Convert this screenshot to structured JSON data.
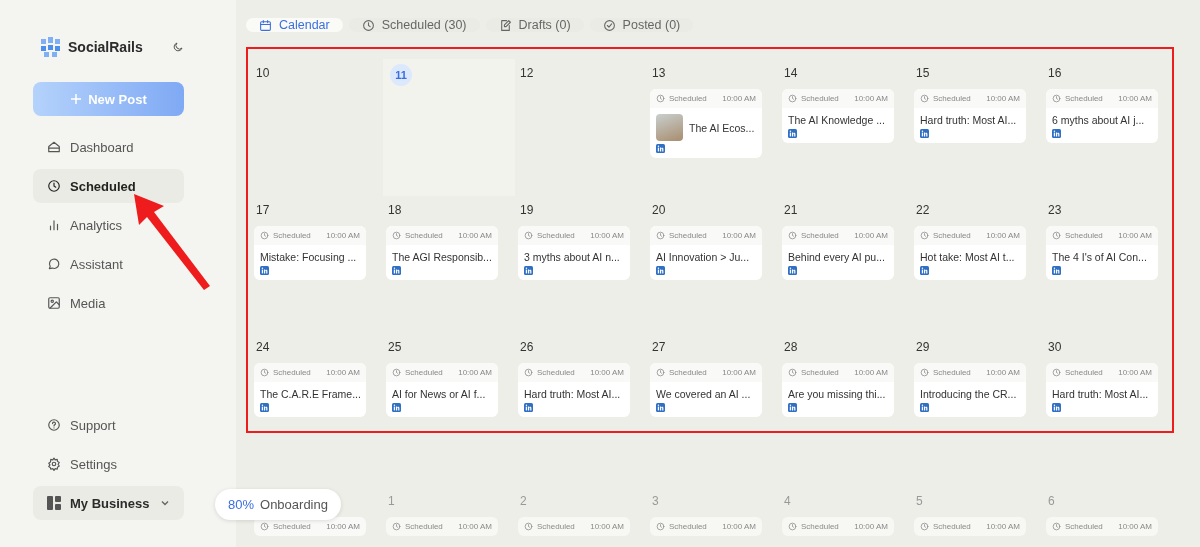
{
  "sidebar": {
    "brand": "SocialRails",
    "new_post": "New Post",
    "nav": [
      {
        "label": "Dashboard",
        "selected": false
      },
      {
        "label": "Scheduled",
        "selected": true
      },
      {
        "label": "Analytics",
        "selected": false
      },
      {
        "label": "Assistant",
        "selected": false
      },
      {
        "label": "Media",
        "selected": false
      }
    ],
    "bottom_nav": [
      {
        "label": "Support"
      },
      {
        "label": "Settings"
      }
    ],
    "workspace": "My Business"
  },
  "onboarding": {
    "percent": "80%",
    "label": "Onboarding"
  },
  "tabs": [
    {
      "label": "Calendar",
      "selected": true
    },
    {
      "label": "Scheduled (30)",
      "selected": false
    },
    {
      "label": "Drafts (0)",
      "selected": false
    },
    {
      "label": "Posted (0)",
      "selected": false
    }
  ],
  "weeks": [
    {
      "highlighted": true,
      "days": [
        {
          "day": "10",
          "today": false,
          "muted": false
        },
        {
          "day": "11",
          "today": true,
          "muted": false
        },
        {
          "day": "12",
          "today": false,
          "muted": false
        },
        {
          "day": "13",
          "today": false,
          "muted": false,
          "posts": [
            {
              "status": "Scheduled",
              "time": "10:00 AM",
              "title": "The AI Ecos...",
              "has_image": true
            }
          ]
        },
        {
          "day": "14",
          "today": false,
          "muted": false,
          "posts": [
            {
              "status": "Scheduled",
              "time": "10:00 AM",
              "title": "The AI Knowledge ...",
              "has_image": false
            }
          ]
        },
        {
          "day": "15",
          "today": false,
          "muted": false,
          "posts": [
            {
              "status": "Scheduled",
              "time": "10:00 AM",
              "title": "Hard truth: Most AI...",
              "has_image": false
            }
          ]
        },
        {
          "day": "16",
          "today": false,
          "muted": false,
          "posts": [
            {
              "status": "Scheduled",
              "time": "10:00 AM",
              "title": "6 myths about AI j...",
              "has_image": false
            }
          ]
        }
      ]
    },
    {
      "highlighted": true,
      "days": [
        {
          "day": "17",
          "today": false,
          "muted": false,
          "posts": [
            {
              "status": "Scheduled",
              "time": "10:00 AM",
              "title": "Mistake: Focusing ...",
              "has_image": false
            }
          ]
        },
        {
          "day": "18",
          "today": false,
          "muted": false,
          "posts": [
            {
              "status": "Scheduled",
              "time": "10:00 AM",
              "title": "The AGI Responsib...",
              "has_image": false
            }
          ]
        },
        {
          "day": "19",
          "today": false,
          "muted": false,
          "posts": [
            {
              "status": "Scheduled",
              "time": "10:00 AM",
              "title": "3 myths about AI n...",
              "has_image": false
            }
          ]
        },
        {
          "day": "20",
          "today": false,
          "muted": false,
          "posts": [
            {
              "status": "Scheduled",
              "time": "10:00 AM",
              "title": "AI Innovation > Ju...",
              "has_image": false
            }
          ]
        },
        {
          "day": "21",
          "today": false,
          "muted": false,
          "posts": [
            {
              "status": "Scheduled",
              "time": "10:00 AM",
              "title": "Behind every AI pu...",
              "has_image": false
            }
          ]
        },
        {
          "day": "22",
          "today": false,
          "muted": false,
          "posts": [
            {
              "status": "Scheduled",
              "time": "10:00 AM",
              "title": "Hot take: Most AI t...",
              "has_image": false
            }
          ]
        },
        {
          "day": "23",
          "today": false,
          "muted": false,
          "posts": [
            {
              "status": "Scheduled",
              "time": "10:00 AM",
              "title": "The 4 I's of AI Con...",
              "has_image": false
            }
          ]
        }
      ]
    },
    {
      "highlighted": true,
      "days": [
        {
          "day": "24",
          "today": false,
          "muted": false,
          "posts": [
            {
              "status": "Scheduled",
              "time": "10:00 AM",
              "title": "The C.A.R.E Frame...",
              "has_image": false
            }
          ]
        },
        {
          "day": "25",
          "today": false,
          "muted": false,
          "posts": [
            {
              "status": "Scheduled",
              "time": "10:00 AM",
              "title": "AI for News or AI f...",
              "has_image": false
            }
          ]
        },
        {
          "day": "26",
          "today": false,
          "muted": false,
          "posts": [
            {
              "status": "Scheduled",
              "time": "10:00 AM",
              "title": "Hard truth: Most AI...",
              "has_image": false
            }
          ]
        },
        {
          "day": "27",
          "today": false,
          "muted": false,
          "posts": [
            {
              "status": "Scheduled",
              "time": "10:00 AM",
              "title": "We covered an AI ...",
              "has_image": false
            }
          ]
        },
        {
          "day": "28",
          "today": false,
          "muted": false,
          "posts": [
            {
              "status": "Scheduled",
              "time": "10:00 AM",
              "title": "Are you missing thi...",
              "has_image": false
            }
          ]
        },
        {
          "day": "29",
          "today": false,
          "muted": false,
          "posts": [
            {
              "status": "Scheduled",
              "time": "10:00 AM",
              "title": "Introducing the CR...",
              "has_image": false
            }
          ]
        },
        {
          "day": "30",
          "today": false,
          "muted": false,
          "posts": [
            {
              "status": "Scheduled",
              "time": "10:00 AM",
              "title": "Hard truth: Most AI...",
              "has_image": false
            }
          ]
        }
      ]
    },
    {
      "highlighted": false,
      "days": [
        {
          "posts": [
            {
              "status": "Scheduled",
              "time": "10:00 AM"
            }
          ]
        },
        {
          "day": "1",
          "today": false,
          "muted": true,
          "posts": [
            {
              "status": "Scheduled",
              "time": "10:00 AM"
            }
          ]
        },
        {
          "day": "2",
          "today": false,
          "muted": true,
          "posts": [
            {
              "status": "Scheduled",
              "time": "10:00 AM"
            }
          ]
        },
        {
          "day": "3",
          "today": false,
          "muted": true,
          "posts": [
            {
              "status": "Scheduled",
              "time": "10:00 AM"
            }
          ]
        },
        {
          "day": "4",
          "today": false,
          "muted": true,
          "posts": [
            {
              "status": "Scheduled",
              "time": "10:00 AM"
            }
          ]
        },
        {
          "day": "5",
          "today": false,
          "muted": true,
          "posts": [
            {
              "status": "Scheduled",
              "time": "10:00 AM"
            }
          ]
        },
        {
          "day": "6",
          "today": false,
          "muted": true,
          "posts": [
            {
              "status": "Scheduled",
              "time": "10:00 AM"
            }
          ]
        }
      ]
    }
  ]
}
